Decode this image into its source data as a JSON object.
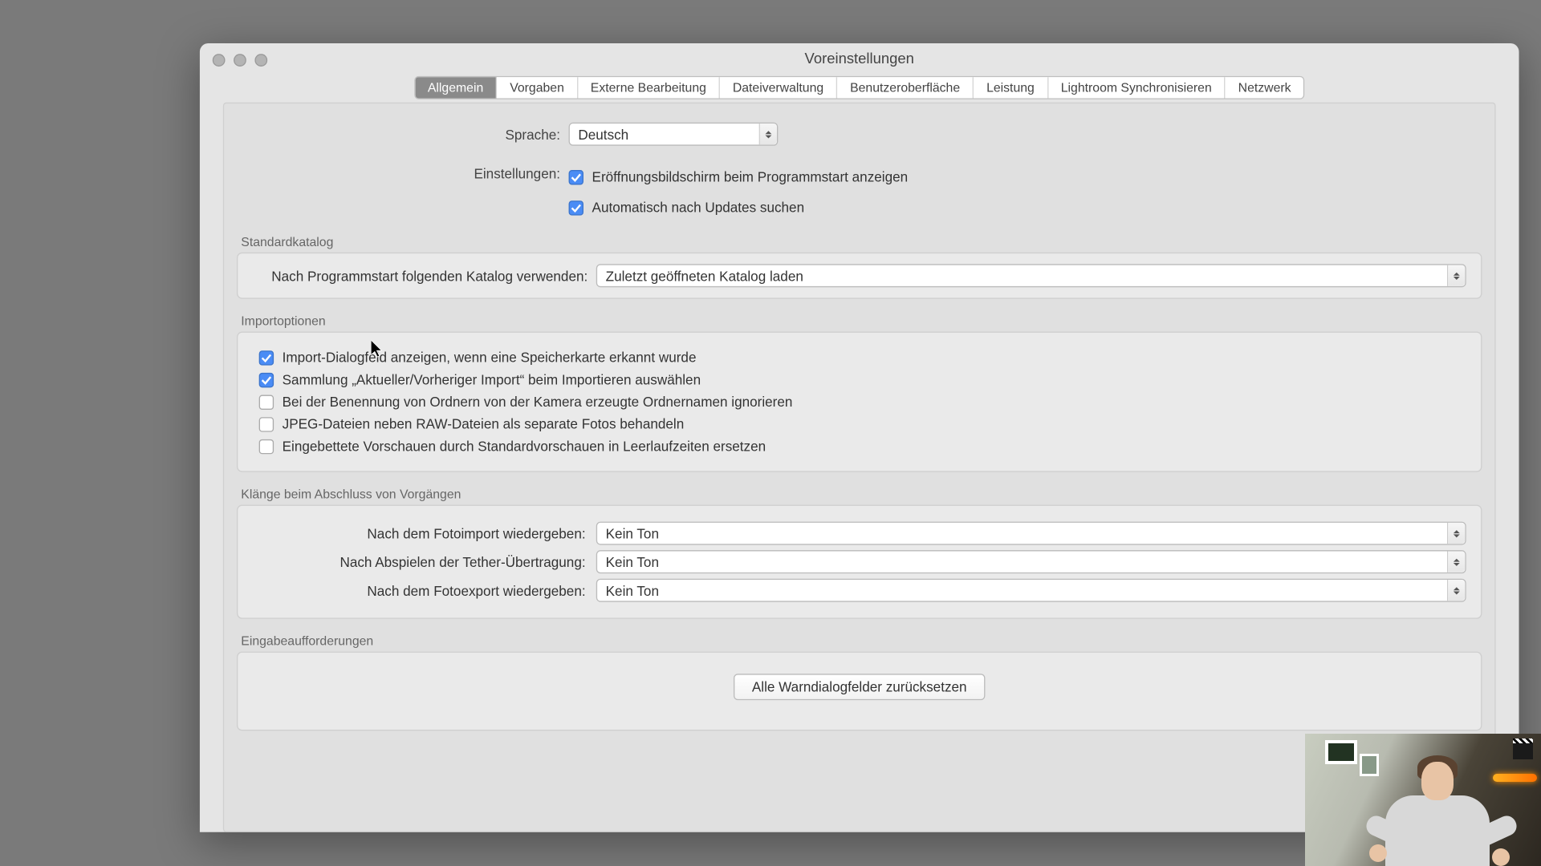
{
  "window": {
    "title": "Voreinstellungen"
  },
  "tabs": [
    "Allgemein",
    "Vorgaben",
    "Externe Bearbeitung",
    "Dateiverwaltung",
    "Benutzeroberfläche",
    "Leistung",
    "Lightroom Synchronisieren",
    "Netzwerk"
  ],
  "lang": {
    "label": "Sprache:",
    "value": "Deutsch"
  },
  "settings": {
    "label": "Einstellungen:",
    "opt1": "Eröffnungsbildschirm beim Programmstart anzeigen",
    "opt2": "Automatisch nach Updates suchen"
  },
  "catalog": {
    "title": "Standardkatalog",
    "label": "Nach Programmstart folgenden Katalog verwenden:",
    "value": "Zuletzt geöffneten Katalog laden"
  },
  "import": {
    "title": "Importoptionen",
    "i1": "Import-Dialogfeld anzeigen, wenn eine Speicherkarte erkannt wurde",
    "i2": "Sammlung „Aktueller/Vorheriger Import“ beim Importieren auswählen",
    "i3": "Bei der Benennung von Ordnern von der Kamera erzeugte Ordnernamen ignorieren",
    "i4": "JPEG-Dateien neben RAW-Dateien als separate Fotos behandeln",
    "i5": "Eingebettete Vorschauen durch Standardvorschauen in Leerlaufzeiten ersetzen"
  },
  "sounds": {
    "title": "Klänge beim Abschluss von Vorgängen",
    "s1_label": "Nach dem Fotoimport wiedergeben:",
    "s2_label": "Nach Abspielen der Tether-Übertragung:",
    "s3_label": "Nach dem Fotoexport wiedergeben:",
    "s1_value": "Kein Ton",
    "s2_value": "Kein Ton",
    "s3_value": "Kein Ton"
  },
  "prompts": {
    "title": "Eingabeaufforderungen",
    "button": "Alle Warndialogfelder zurücksetzen"
  }
}
